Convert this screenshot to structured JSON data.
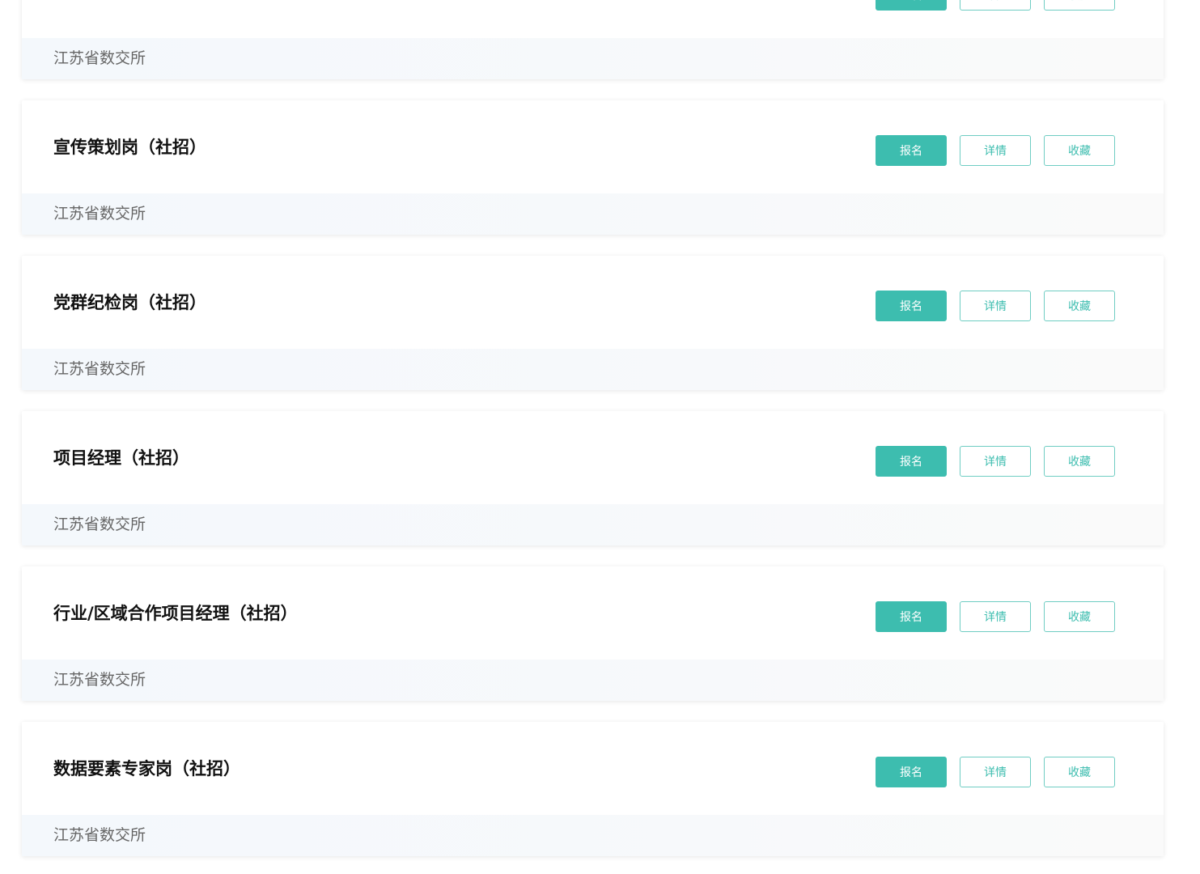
{
  "buttons": {
    "apply": "报名",
    "detail": "详情",
    "favorite": "收藏"
  },
  "colors": {
    "accent": "#3dbdaf",
    "title": "#111111",
    "org": "#666666"
  },
  "jobs": [
    {
      "title": "",
      "org": "江苏省数交所"
    },
    {
      "title": "宣传策划岗（社招）",
      "org": "江苏省数交所"
    },
    {
      "title": "党群纪检岗（社招）",
      "org": "江苏省数交所"
    },
    {
      "title": "项目经理（社招）",
      "org": "江苏省数交所"
    },
    {
      "title": "行业/区域合作项目经理（社招）",
      "org": "江苏省数交所"
    },
    {
      "title": "数据要素专家岗（社招）",
      "org": "江苏省数交所"
    }
  ]
}
